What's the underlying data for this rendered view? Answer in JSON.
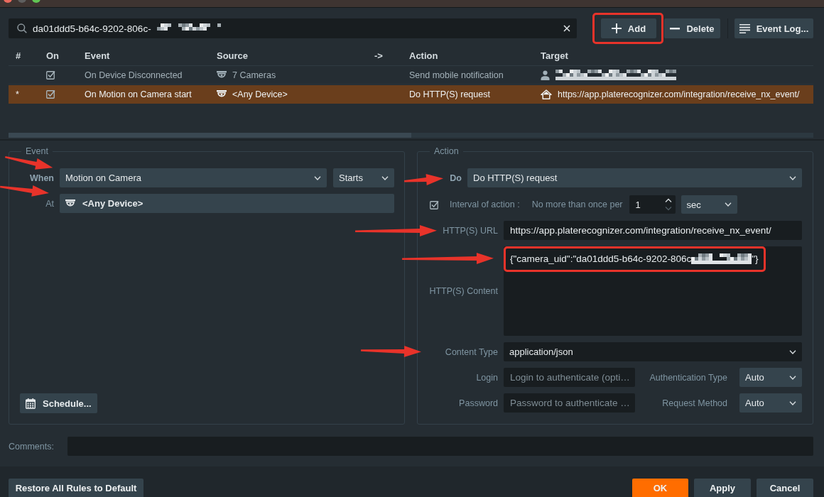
{
  "toolbar": {
    "search": {
      "value": "da01ddd5-b64c-9202-806c-",
      "redacted": true
    },
    "buttons": [
      {
        "kind": "add",
        "label": "Add",
        "highlighted": true
      },
      {
        "kind": "delete",
        "label": "Delete",
        "highlighted": false
      },
      {
        "kind": "log",
        "label": "Event Log...",
        "highlighted": false
      }
    ]
  },
  "table": {
    "columns": [
      "#",
      "On",
      "Event",
      "Source",
      "->",
      "Action",
      "Target"
    ],
    "rows": [
      {
        "selected": false,
        "on": true,
        "event": "On Device Disconnected",
        "source": "7 Cameras",
        "action": "Send mobile notification",
        "target": {
          "kind": "user",
          "redacted": true
        }
      },
      {
        "selected": true,
        "marker": "*",
        "on": true,
        "event": "On Motion on Camera start",
        "source": "<Any Device>",
        "action": "Do HTTP(S) request",
        "target": {
          "kind": "url",
          "text": "https://app.platerecognizer.com/integration/receive_nx_event/"
        }
      }
    ]
  },
  "event_panel": {
    "title": "Event",
    "when": {
      "label": "When",
      "value": "Motion on Camera",
      "arrow": true
    },
    "state": {
      "value": "Starts"
    },
    "at": {
      "label": "At",
      "value": "<Any Device>",
      "arrow": true
    },
    "schedule_button": "Schedule..."
  },
  "action_panel": {
    "title": "Action",
    "do": {
      "label": "Do",
      "value": "Do HTTP(S) request",
      "arrow": true
    },
    "interval": {
      "checked": true,
      "label": "Interval of action :",
      "text": "No more than once per",
      "value": "1",
      "unit": "sec"
    },
    "fields": [
      {
        "kind": "text",
        "label": "HTTP(S) URL",
        "value": "https://app.platerecognizer.com/integration/receive_nx_event/",
        "arrow": true
      },
      {
        "kind": "textarea",
        "label": "HTTP(S) Content",
        "value": "{\"camera_uid\":\"da01ddd5-b64c-9202-806c",
        "value_end": "\"}",
        "redacted": true,
        "arrow": true,
        "highlighted": true
      },
      {
        "kind": "select",
        "label": "Content Type",
        "value": "application/json",
        "arrow": true
      }
    ],
    "auth": [
      {
        "label": "Login",
        "placeholder": "Login to authenticate (opti…",
        "option_label": "Authentication Type",
        "option_value": "Auto"
      },
      {
        "label": "Password",
        "placeholder": "Password to authenticate …",
        "option_label": "Request Method",
        "option_value": "Auto"
      }
    ]
  },
  "comments": {
    "label": "Comments:"
  },
  "footer": {
    "restore_button": "Restore All Rules to Default",
    "buttons": [
      {
        "label": "OK",
        "primary": true
      },
      {
        "label": "Apply",
        "primary": false
      },
      {
        "label": "Cancel",
        "primary": false
      }
    ]
  }
}
